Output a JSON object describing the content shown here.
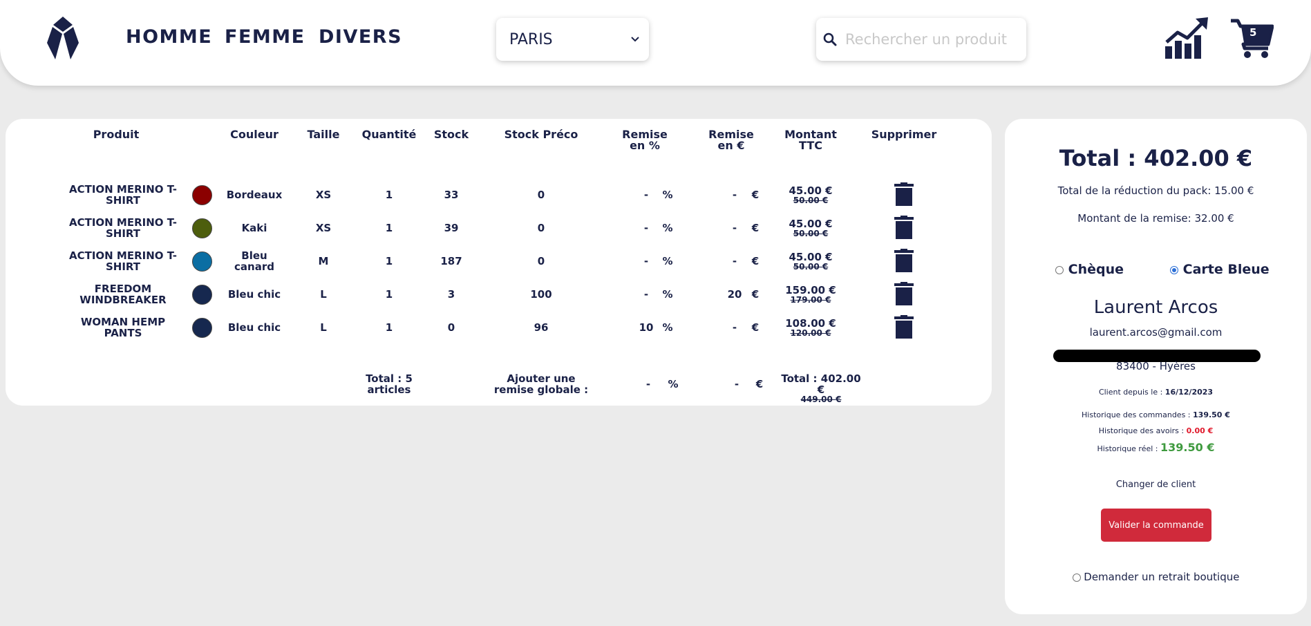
{
  "header": {
    "nav": [
      "HOMME",
      "FEMME",
      "DIVERS"
    ],
    "store": "PARIS",
    "search_placeholder": "Rechercher un produit",
    "cart_count": "5"
  },
  "cart": {
    "columns": {
      "product": "Produit",
      "color": "Couleur",
      "size": "Taille",
      "quantity": "Quantité",
      "stock": "Stock",
      "stock_preco": "Stock Préco",
      "discount_pct": "Remise en %",
      "discount_eur": "Remise en €",
      "amount": "Montant TTC",
      "delete": "Supprimer"
    },
    "rows": [
      {
        "name": "ACTION MERINO T-SHIRT",
        "swatch": "#8b0000",
        "color": "Bordeaux",
        "size": "XS",
        "qty": "1",
        "stock": "33",
        "preco": "0",
        "pct": "-",
        "pct_unit": "%",
        "eur": "-",
        "eur_unit": "€",
        "price": "45.00 €",
        "old_price": "50.00 €"
      },
      {
        "name": "ACTION MERINO T-SHIRT",
        "swatch": "#4d5e0d",
        "color": "Kaki",
        "size": "XS",
        "qty": "1",
        "stock": "39",
        "preco": "0",
        "pct": "-",
        "pct_unit": "%",
        "eur": "-",
        "eur_unit": "€",
        "price": "45.00 €",
        "old_price": "50.00 €"
      },
      {
        "name": "ACTION MERINO T-SHIRT",
        "swatch": "#0b6ea3",
        "color": "Bleu canard",
        "size": "M",
        "qty": "1",
        "stock": "187",
        "preco": "0",
        "pct": "-",
        "pct_unit": "%",
        "eur": "-",
        "eur_unit": "€",
        "price": "45.00 €",
        "old_price": "50.00 €"
      },
      {
        "name": "FREEDOM WINDBREAKER",
        "swatch": "#16284f",
        "color": "Bleu chic",
        "size": "L",
        "qty": "1",
        "stock": "3",
        "preco": "100",
        "pct": "-",
        "pct_unit": "%",
        "eur": "20",
        "eur_unit": "€",
        "price": "159.00 €",
        "old_price": "179.00 €"
      },
      {
        "name": "WOMAN HEMP PANTS",
        "swatch": "#16284f",
        "color": "Bleu chic",
        "size": "L",
        "qty": "1",
        "stock": "0",
        "preco": "96",
        "pct": "10",
        "pct_unit": "%",
        "eur": "-",
        "eur_unit": "€",
        "price": "108.00 €",
        "old_price": "120.00 €"
      }
    ],
    "footer": {
      "total_articles": "Total : 5 articles",
      "global_discount_label": "Ajouter une remise globale :",
      "global_pct": "-",
      "global_pct_unit": "%",
      "global_eur": "-",
      "global_eur_unit": "€",
      "total": "Total : 402.00 €",
      "total_old": "449.00 €"
    }
  },
  "summary": {
    "total": "Total : 402.00 €",
    "pack_reduction": "Total de la réduction du pack: 15.00 €",
    "discount_amount": "Montant de la remise: 32.00 €",
    "payment": {
      "cheque": "Chèque",
      "card": "Carte Bleue",
      "selected": "card"
    },
    "client_name": "Laurent Arcos",
    "client_email": "laurent.arcos@gmail.com",
    "client_city": "83400 - Hyères",
    "client_since_label": "Client depuis le :",
    "client_since": "16/12/2023",
    "orders_history_label": "Historique des commandes :",
    "orders_history": "139.50 €",
    "credits_history_label": "Historique des avoirs :",
    "credits_history": "0.00 €",
    "real_history_label": "Historique réel :",
    "real_history": "139.50 €",
    "change_client": "Changer de client",
    "validate": "Valider la commande",
    "store_pickup": "Demander un retrait boutique"
  },
  "colors": {
    "navy": "#1a2147",
    "red": "#d02a3b",
    "green": "#3f9a3f",
    "credit_red": "#e0192b"
  }
}
